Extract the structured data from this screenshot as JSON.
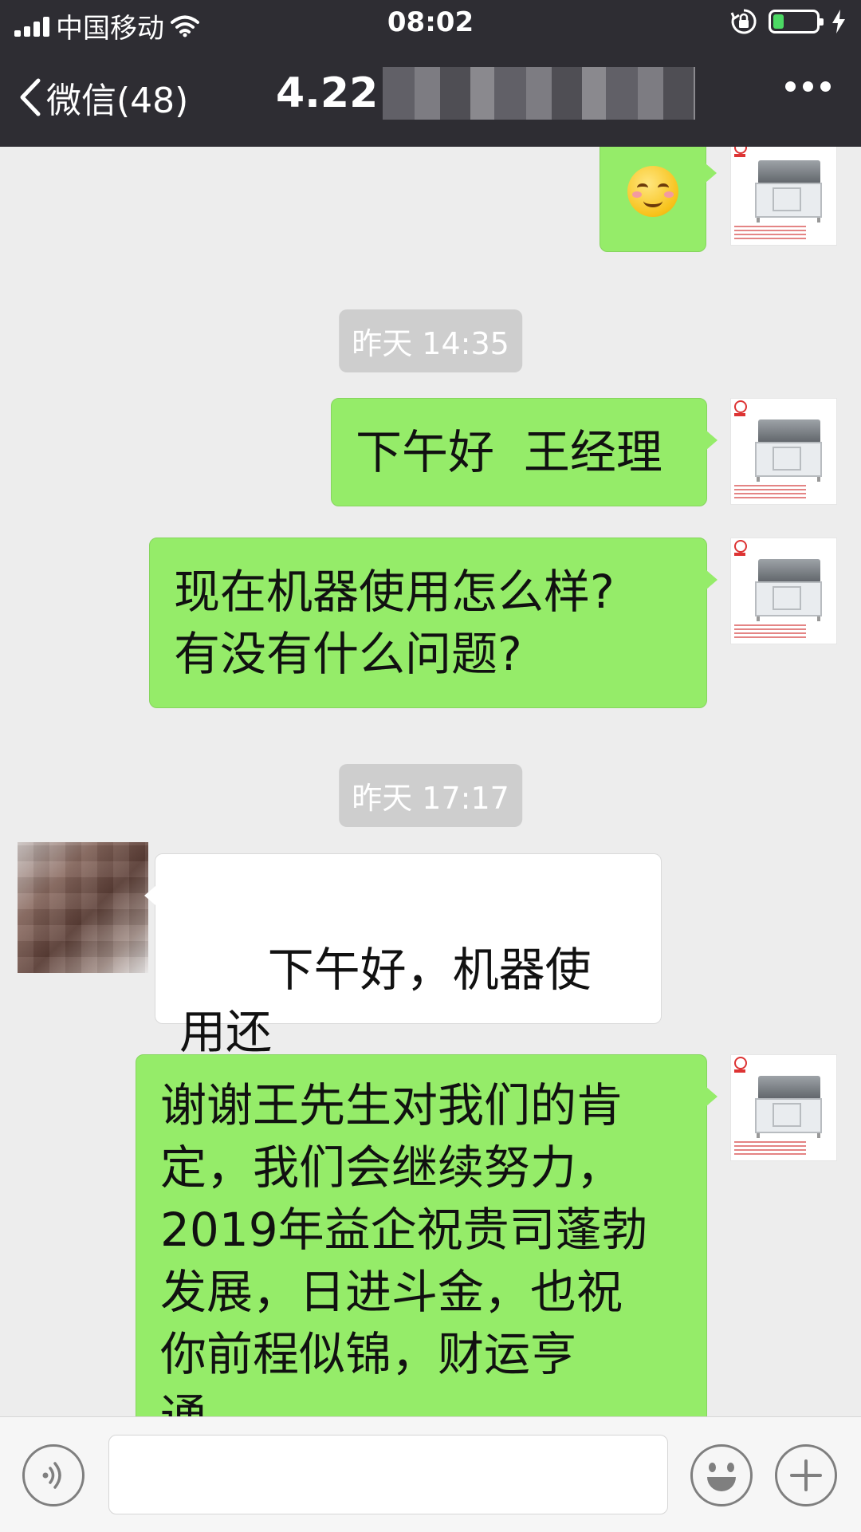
{
  "status_bar": {
    "carrier": "中国移动",
    "time": "08:02"
  },
  "nav": {
    "back_label": "微信(48)",
    "chat_title": "4.22"
  },
  "messages": [
    {
      "kind": "sent",
      "text": "",
      "icon": "smiling-face-emoji"
    },
    {
      "kind": "timestamp",
      "text": "昨天 14:35"
    },
    {
      "kind": "sent",
      "text": "下午好  王经理"
    },
    {
      "kind": "sent",
      "text": "现在机器使用怎么样?\n有没有什么问题?"
    },
    {
      "kind": "timestamp",
      "text": "昨天 17:17"
    },
    {
      "kind": "received",
      "text": "下午好，机器使用还\n好，没什么问题",
      "icon": "grinning-face-emoji"
    },
    {
      "kind": "sent",
      "text": "谢谢王先生对我们的肯\n定，我们会继续努力，\n2019年益企祝贵司蓬勃\n发展，日进斗金，也祝\n你前程似锦，财运亨\n通"
    }
  ],
  "input_bar": {
    "voice_icon": "voice-icon",
    "emoji_icon": "emoji-icon",
    "plus_icon": "plus-icon",
    "input_value": ""
  },
  "colors": {
    "header_bg": "#2e2d33",
    "chat_bg": "#ededed",
    "sent_bubble": "#95ec69",
    "received_bubble": "#ffffff",
    "timestamp_bg": "#cecece"
  }
}
